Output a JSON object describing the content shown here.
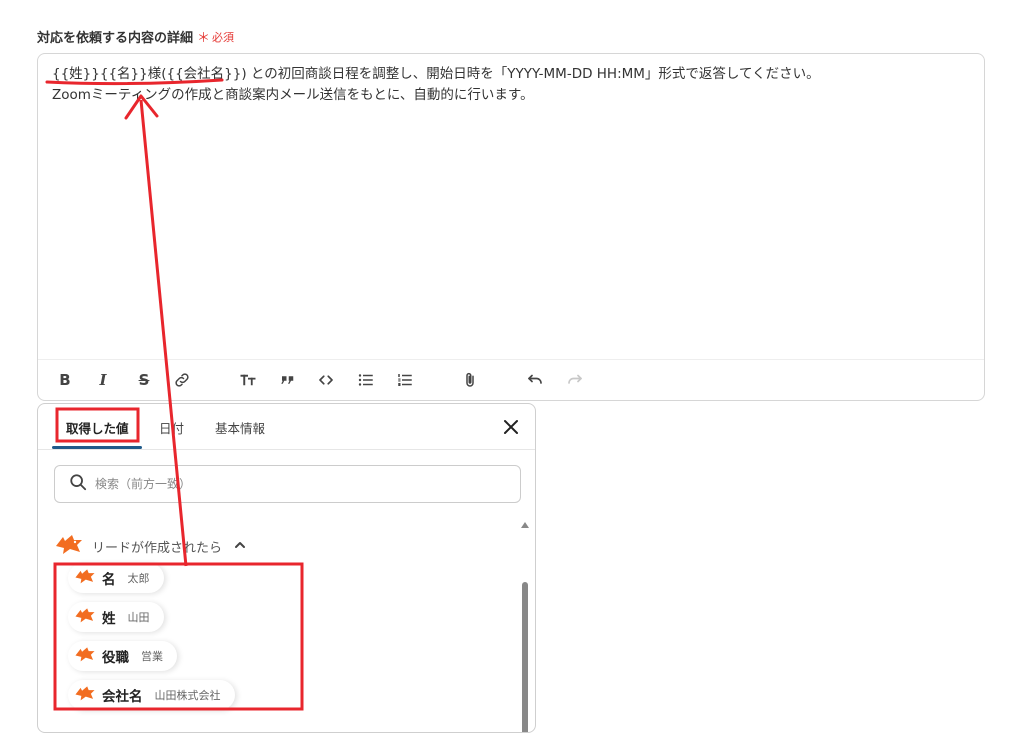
{
  "field": {
    "label": "対応を依頼する内容の詳細",
    "required_mark": "＊",
    "required_text": "必須"
  },
  "editor": {
    "line1_vars": "{{姓}}{{名}}様({{会社名}})",
    "line1_rest": "との初回商談日程を調整し、開始日時を「YYYY-MM-DD HH:MM」形式で返答してください。",
    "line2": "Zoomミーティングの作成と商談案内メール送信をもとに、自動的に行います。"
  },
  "toolbar": {
    "bold": "B",
    "italic": "I",
    "strike": "S",
    "icons": [
      "bold-icon",
      "italic-icon",
      "strikethrough-icon",
      "link-icon",
      "text-size-icon",
      "quote-icon",
      "code-icon",
      "bullet-list-icon",
      "numbered-list-icon",
      "attachment-icon",
      "undo-icon",
      "redo-icon"
    ]
  },
  "panel": {
    "tabs": [
      {
        "label": "取得した値",
        "active": true
      },
      {
        "label": "日付",
        "active": false
      },
      {
        "label": "基本情報",
        "active": false
      }
    ],
    "search_placeholder": "検索（前方一致）",
    "group": {
      "label": "リードが作成されたら",
      "items": [
        {
          "name": "名",
          "value": "太郎"
        },
        {
          "name": "姓",
          "value": "山田"
        },
        {
          "name": "役職",
          "value": "営業"
        },
        {
          "name": "会社名",
          "value": "山田株式会社"
        }
      ]
    }
  },
  "colors": {
    "annotation": "#e8262d",
    "tab_underline": "#1f5a8a",
    "required": "#e53935",
    "brand_icon": "#f26d21"
  }
}
